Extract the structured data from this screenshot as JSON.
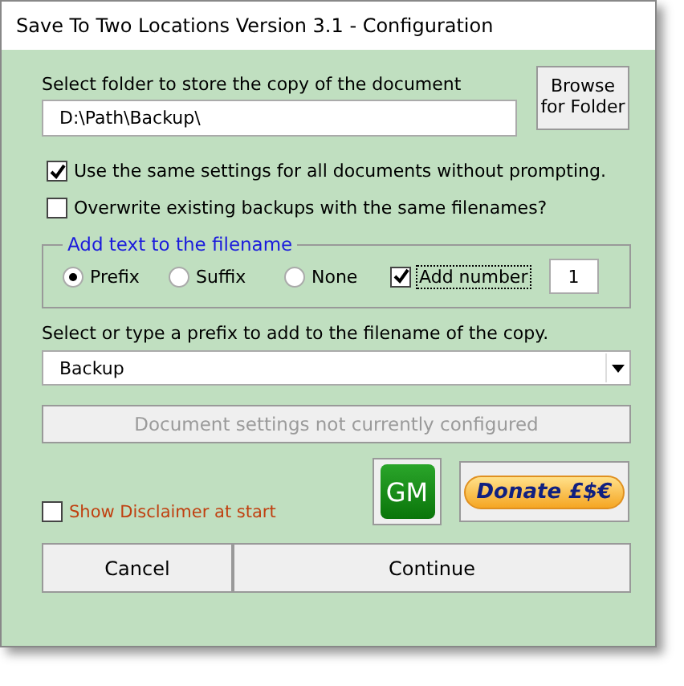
{
  "window": {
    "title": "Save To Two Locations Version 3.1 - Configuration"
  },
  "folder": {
    "label": "Select folder to store the copy of the document",
    "value": "D:\\Path\\Backup\\",
    "browse_button": "Browse for Folder"
  },
  "options": [
    {
      "label": "Use the same settings for all documents without prompting.",
      "checked": true
    },
    {
      "label": "Overwrite existing backups with the same filenames?",
      "checked": false
    }
  ],
  "filename_group": {
    "title": "Add text to the filename",
    "radios": [
      {
        "label": "Prefix",
        "selected": true
      },
      {
        "label": "Suffix",
        "selected": false
      },
      {
        "label": "None",
        "selected": false
      }
    ],
    "add_number": {
      "label": "Add number",
      "checked": true
    },
    "number": "1"
  },
  "prefix": {
    "label": "Select or type a prefix to add to the filename of the copy.",
    "value": "Backup"
  },
  "settings_button": {
    "label": "Document settings not currently configured",
    "disabled": true
  },
  "gm_button": "GM",
  "donate_button": "Donate £$€",
  "disclaimer": {
    "label": "Show Disclaimer at start",
    "checked": false
  },
  "buttons": [
    "Cancel",
    "Continue"
  ]
}
